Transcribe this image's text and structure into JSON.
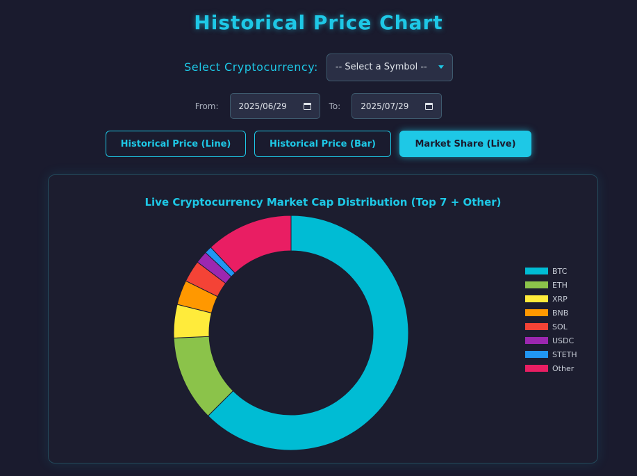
{
  "page": {
    "title": "Historical Price Chart"
  },
  "controls": {
    "select_label": "Select Cryptocurrency:",
    "select_value": "-- Select a Symbol --",
    "from_label": "From:",
    "from_value": "2025/06/29",
    "to_label": "To:",
    "to_value": "2025/07/29"
  },
  "buttons": [
    {
      "label": "Historical Price (Line)",
      "active": false
    },
    {
      "label": "Historical Price (Bar)",
      "active": false
    },
    {
      "label": "Market Share (Live)",
      "active": true
    }
  ],
  "colors": {
    "accent": "#1ec8e6",
    "background": "#1a1b2e"
  },
  "chart_data": {
    "type": "pie",
    "donut": true,
    "title": "Live Cryptocurrency Market Cap Distribution (Top 7 + Other)",
    "legend_position": "right",
    "categories": [
      "BTC",
      "ETH",
      "XRP",
      "BNB",
      "SOL",
      "USDC",
      "STETH",
      "Other"
    ],
    "values": [
      62.5,
      11.8,
      4.6,
      3.4,
      3.0,
      1.7,
      1.0,
      12.0
    ],
    "colors": [
      "#00bcd4",
      "#8bc34a",
      "#ffeb3b",
      "#ff9800",
      "#f44336",
      "#9c27b0",
      "#2196f3",
      "#e91e63"
    ]
  }
}
